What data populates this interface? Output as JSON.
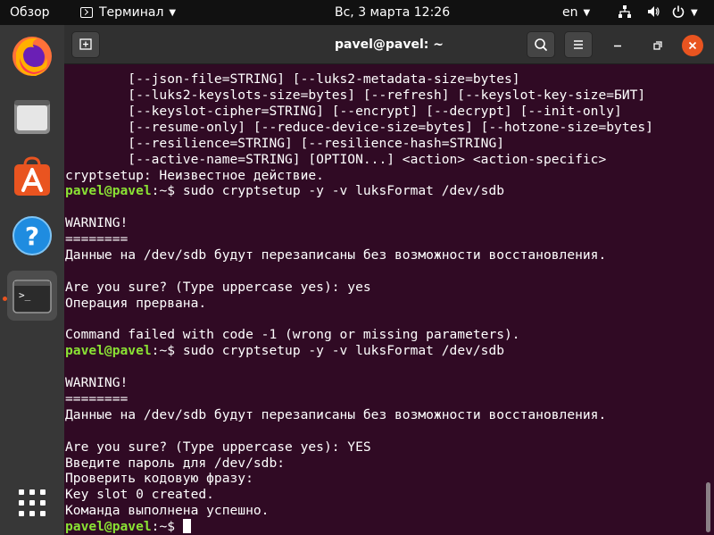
{
  "topbar": {
    "activities": "Обзор",
    "app_name": "Терминал",
    "clock": "Вс, 3 марта  12:26",
    "lang": "en"
  },
  "dock": {
    "items": [
      {
        "name": "firefox",
        "icon": "firefox-icon"
      },
      {
        "name": "files",
        "icon": "files-icon"
      },
      {
        "name": "software",
        "icon": "software-store-icon"
      },
      {
        "name": "help",
        "icon": "help-icon"
      },
      {
        "name": "terminal",
        "icon": "terminal-icon",
        "active": true
      }
    ],
    "apps_grid_icon": "show-apps-icon"
  },
  "window": {
    "title": "pavel@pavel: ~"
  },
  "terminal": {
    "lines": [
      {
        "text": "        [--json-file=STRING] [--luks2-metadata-size=bytes]"
      },
      {
        "text": "        [--luks2-keyslots-size=bytes] [--refresh] [--keyslot-key-size=БИТ]"
      },
      {
        "text": "        [--keyslot-cipher=STRING] [--encrypt] [--decrypt] [--init-only]"
      },
      {
        "text": "        [--resume-only] [--reduce-device-size=bytes] [--hotzone-size=bytes]"
      },
      {
        "text": "        [--resilience=STRING] [--resilience-hash=STRING]"
      },
      {
        "text": "        [--active-name=STRING] [OPTION...] <action> <action-specific>"
      },
      {
        "text": "cryptsetup: Неизвестное действие."
      },
      {
        "prompt": "pavel@pavel",
        "path": ":~$ ",
        "text": "sudo cryptsetup -y -v luksFormat /dev/sdb"
      },
      {
        "text": ""
      },
      {
        "text": "WARNING!"
      },
      {
        "text": "========"
      },
      {
        "text": "Данные на /dev/sdb будут перезаписаны без возможности восстановления."
      },
      {
        "text": ""
      },
      {
        "text": "Are you sure? (Type uppercase yes): yes"
      },
      {
        "text": "Операция прервана."
      },
      {
        "text": ""
      },
      {
        "text": "Command failed with code -1 (wrong or missing parameters)."
      },
      {
        "prompt": "pavel@pavel",
        "path": ":~$ ",
        "text": "sudo cryptsetup -y -v luksFormat /dev/sdb"
      },
      {
        "text": ""
      },
      {
        "text": "WARNING!"
      },
      {
        "text": "========"
      },
      {
        "text": "Данные на /dev/sdb будут перезаписаны без возможности восстановления."
      },
      {
        "text": ""
      },
      {
        "text": "Are you sure? (Type uppercase yes): YES"
      },
      {
        "text": "Введите пароль для /dev/sdb:"
      },
      {
        "text": "Проверить кодовую фразу:"
      },
      {
        "text": "Key slot 0 created."
      },
      {
        "text": "Команда выполнена успешно."
      },
      {
        "prompt": "pavel@pavel",
        "path": ":~$ ",
        "text": "",
        "cursor": true
      }
    ]
  },
  "colors": {
    "accent": "#e95420",
    "terminal_bg": "#300a24",
    "prompt": "#8ae234"
  }
}
